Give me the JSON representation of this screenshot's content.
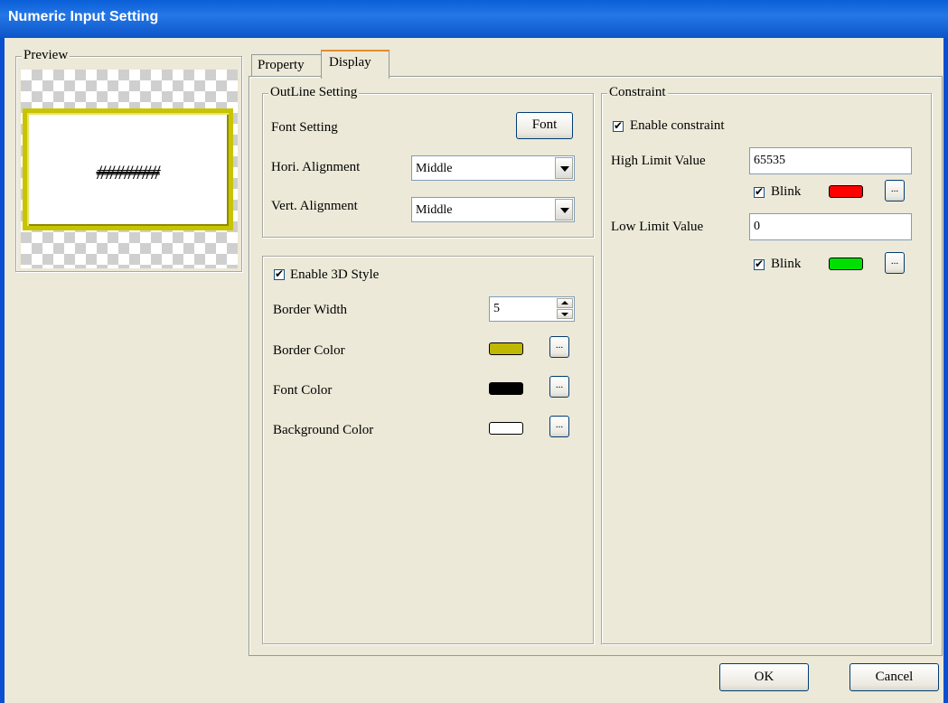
{
  "window": {
    "title": "Numeric Input Setting"
  },
  "preview": {
    "label": "Preview",
    "sample_text": "#######"
  },
  "tabs": [
    {
      "label": "Property"
    },
    {
      "label": "Display"
    }
  ],
  "outline": {
    "label": "OutLine Setting",
    "font_setting_label": "Font Setting",
    "font_button": "Font",
    "hori_label": "Hori. Alignment",
    "hori_value": "Middle",
    "vert_label": "Vert. Alignment",
    "vert_value": "Middle"
  },
  "style3d": {
    "enable_label": "Enable 3D Style",
    "border_width_label": "Border Width",
    "border_width_value": "5",
    "border_color_label": "Border Color",
    "border_color": "#c0b800",
    "font_color_label": "Font Color",
    "font_color": "#000000",
    "bg_color_label": "Background Color",
    "bg_color": "#ffffff",
    "pick_button": "..."
  },
  "constraint": {
    "label": "Constraint",
    "enable_label": "Enable constraint",
    "high_label": "High Limit Value",
    "high_value": "65535",
    "high_blink_label": "Blink",
    "high_color": "#ff0000",
    "low_label": "Low Limit Value",
    "low_value": "0",
    "low_blink_label": "Blink",
    "low_color": "#00e000",
    "pick_button": "..."
  },
  "footer": {
    "ok": "OK",
    "cancel": "Cancel"
  }
}
